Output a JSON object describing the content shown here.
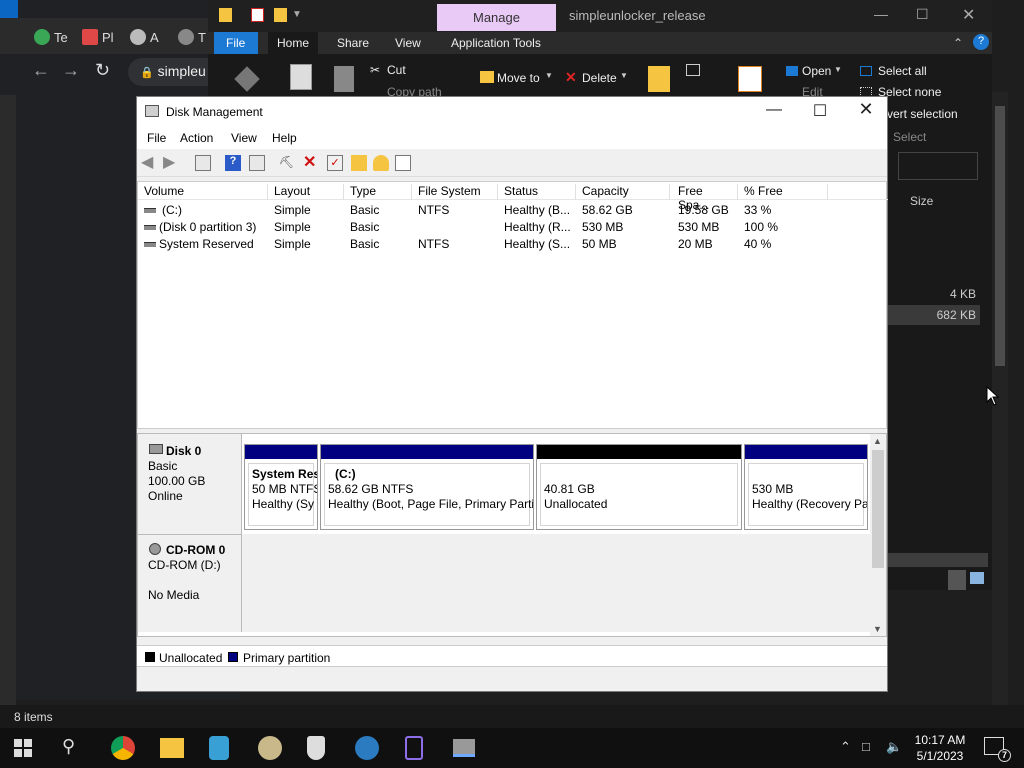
{
  "browser": {
    "tabs": [
      {
        "label": "Te",
        "color": "#3aa757"
      },
      {
        "label": "Pl",
        "color": "#e04848"
      },
      {
        "label": "A",
        "color": "#bbbbbb"
      },
      {
        "label": "T",
        "color": "#888888"
      }
    ],
    "address": "simpleu"
  },
  "explorer": {
    "contextual_tab": "Manage",
    "window_title": "simpleunlocker_release",
    "menu": {
      "file": "File",
      "home": "Home",
      "share": "Share",
      "view": "View",
      "tools": "Application Tools"
    },
    "ribbon": {
      "cut": "Cut",
      "copy_path": "Copy path",
      "move_to": "Move to",
      "delete": "Delete",
      "open": "Open",
      "edit": "Edit",
      "select_all": "Select all",
      "select_none": "Select none",
      "invert_selection": "vert selection",
      "select_group": "Select"
    },
    "column_size": "Size",
    "sizes": [
      "4 KB",
      "682 KB"
    ],
    "status_items": "8 items"
  },
  "disk_management": {
    "title": "Disk Management",
    "menu": [
      "File",
      "Action",
      "View",
      "Help"
    ],
    "columns": [
      "Volume",
      "Layout",
      "Type",
      "File System",
      "Status",
      "Capacity",
      "Free Spa...",
      "% Free"
    ],
    "volumes": [
      {
        "volume": "(C:)",
        "layout": "Simple",
        "type": "Basic",
        "fs": "NTFS",
        "status": "Healthy (B...",
        "capacity": "58.62 GB",
        "free": "19.58 GB",
        "pct": "33 %"
      },
      {
        "volume": "(Disk 0 partition 3)",
        "layout": "Simple",
        "type": "Basic",
        "fs": "",
        "status": "Healthy (R...",
        "capacity": "530 MB",
        "free": "530 MB",
        "pct": "100 %"
      },
      {
        "volume": "System Reserved",
        "layout": "Simple",
        "type": "Basic",
        "fs": "NTFS",
        "status": "Healthy (S...",
        "capacity": "50 MB",
        "free": "20 MB",
        "pct": "40 %"
      }
    ],
    "disk0": {
      "name": "Disk 0",
      "kind": "Basic",
      "size": "100.00 GB",
      "state": "Online",
      "partitions": [
        {
          "title": "System Res",
          "line2": "50 MB NTFS",
          "line3": "Healthy (Sy",
          "bar_color": "#000080"
        },
        {
          "title": "(C:)",
          "line2": "58.62 GB NTFS",
          "line3": "Healthy (Boot, Page File, Primary Parti",
          "bar_color": "#000080"
        },
        {
          "title": "",
          "line2": "40.81 GB",
          "line3": "Unallocated",
          "bar_color": "#000000"
        },
        {
          "title": "",
          "line2": "530 MB",
          "line3": "Healthy (Recovery Pa",
          "bar_color": "#000080"
        }
      ]
    },
    "cdrom": {
      "name": "CD-ROM 0",
      "kind": "CD-ROM (D:)",
      "media": "No Media"
    },
    "legend": [
      {
        "label": "Unallocated",
        "color": "#000000"
      },
      {
        "label": "Primary partition",
        "color": "#000080"
      }
    ]
  },
  "taskbar": {
    "time": "10:17 AM",
    "date": "5/1/2023",
    "notification_count": "7"
  }
}
